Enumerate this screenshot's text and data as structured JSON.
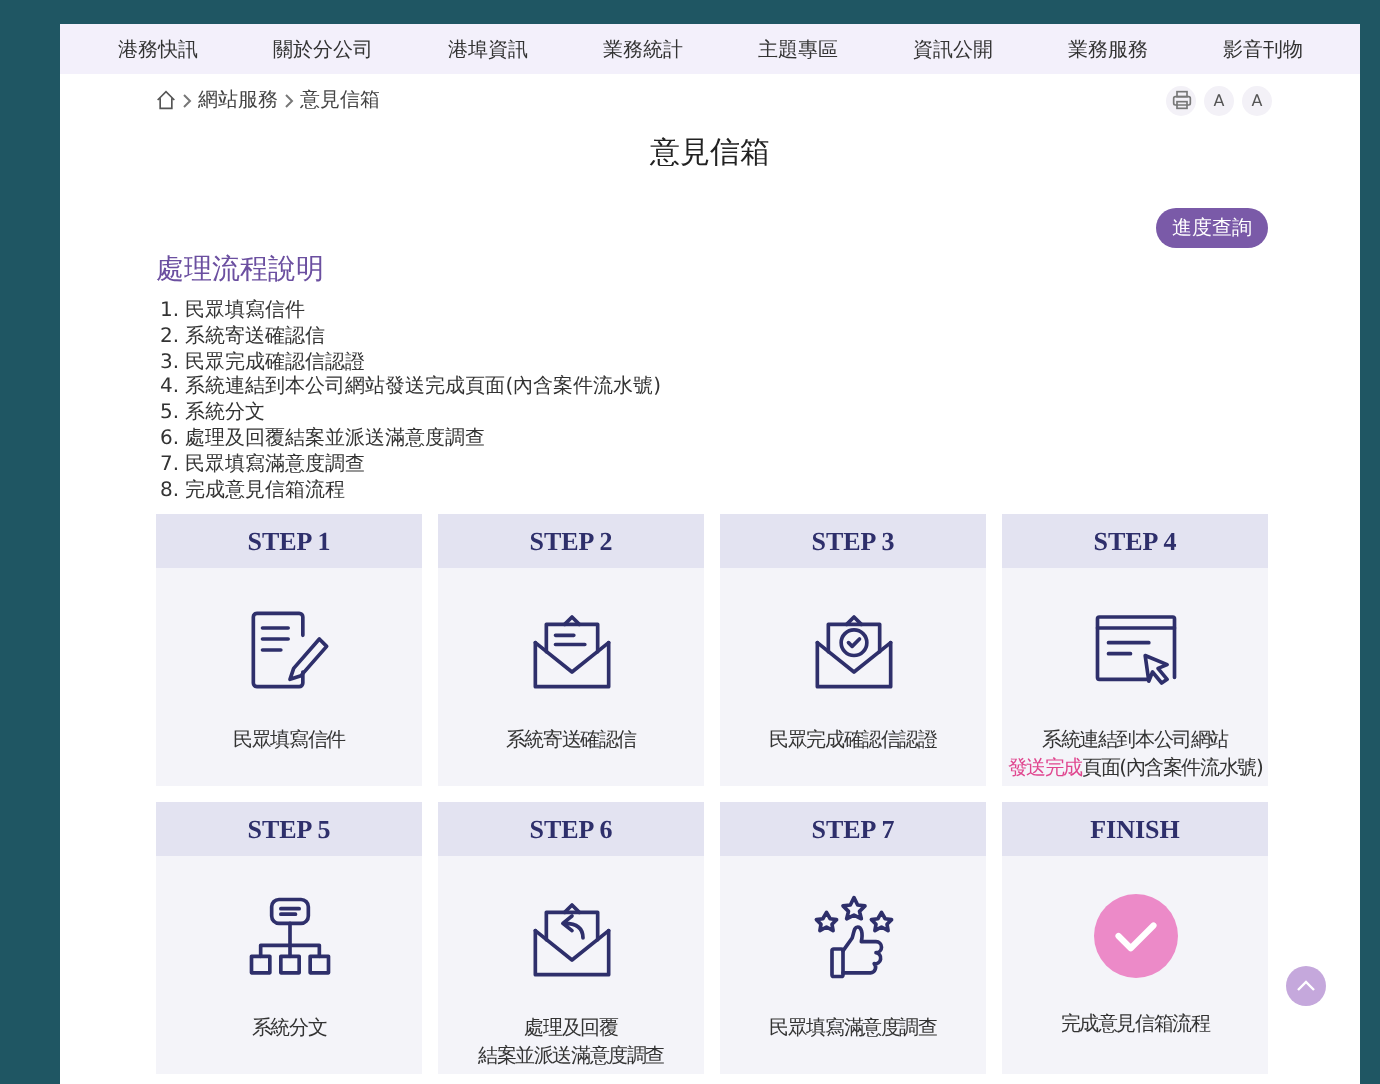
{
  "nav": {
    "items": [
      "港務快訊",
      "關於分公司",
      "港埠資訊",
      "業務統計",
      "主題專區",
      "資訊公開",
      "業務服務",
      "影音刊物"
    ]
  },
  "breadcrumb": [
    "網站服務",
    "意見信箱"
  ],
  "tools": [
    {
      "kind": "print"
    },
    {
      "kind": "font-smaller",
      "label": "A"
    },
    {
      "kind": "font-larger",
      "label": "A"
    }
  ],
  "page_title": "意見信箱",
  "progress_button": "進度查詢",
  "section_title": "處理流程說明",
  "process_list": [
    "1. 民眾填寫信件",
    "2. 系統寄送確認信",
    "3. 民眾完成確認信認證",
    "4. 系統連結到本公司網站發送完成頁面(內含案件流水號)",
    "5. 系統分文",
    "6. 處理及回覆結案並派送滿意度調查",
    "7. 民眾填寫滿意度調查",
    "8. 完成意見信箱流程"
  ],
  "steps": [
    {
      "title": "STEP 1",
      "lines": [
        [
          {
            "text": "民眾填寫信件",
            "highlight": false
          }
        ]
      ]
    },
    {
      "title": "STEP 2",
      "lines": [
        [
          {
            "text": "系統寄送確認信",
            "highlight": false
          }
        ]
      ]
    },
    {
      "title": "STEP 3",
      "lines": [
        [
          {
            "text": "民眾完成確認信認證",
            "highlight": false
          }
        ]
      ]
    },
    {
      "title": "STEP 4",
      "lines": [
        [
          {
            "text": "系統連結到本公司網站",
            "highlight": false
          }
        ],
        [
          {
            "text": "發送完成",
            "highlight": true
          },
          {
            "text": "頁面(內含案件流水號)",
            "highlight": false
          }
        ]
      ]
    },
    {
      "title": "STEP 5",
      "lines": [
        [
          {
            "text": "系統分文",
            "highlight": false
          }
        ]
      ]
    },
    {
      "title": "STEP 6",
      "lines": [
        [
          {
            "text": "處理及回覆",
            "highlight": false
          }
        ],
        [
          {
            "text": "結案並派送滿意度調查",
            "highlight": false
          }
        ]
      ]
    },
    {
      "title": "STEP 7",
      "lines": [
        [
          {
            "text": "民眾填寫滿意度調查",
            "highlight": false
          }
        ]
      ]
    },
    {
      "title": "FINISH",
      "lines": [
        [
          {
            "text": "完成意見信箱流程",
            "highlight": false
          }
        ]
      ]
    }
  ]
}
